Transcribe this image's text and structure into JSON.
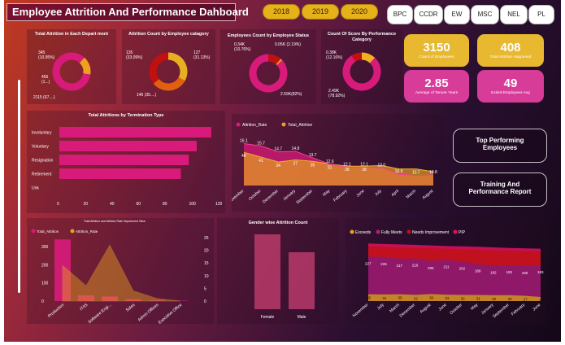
{
  "header": {
    "title": "Employee Attrition And Performance Dahboard"
  },
  "years": [
    "2018",
    "2019",
    "2020"
  ],
  "departments": [
    "BPC",
    "CCDR",
    "EW",
    "MSC",
    "NEL",
    "PL"
  ],
  "kpis": [
    {
      "value": "3150",
      "label": "Count of  Employees",
      "color": "#e8b830"
    },
    {
      "value": "408",
      "label": "Total Attrition Happened",
      "color": "#e8b830"
    },
    {
      "value": "2.85",
      "label": "Average of Tenure Years",
      "color": "#d63c98"
    },
    {
      "value": "49",
      "label": "Exited Employees Avg",
      "color": "#d63c98"
    }
  ],
  "nav_buttons": {
    "top_performing": "Top Performing Employees",
    "training": "Training And Performance Report"
  },
  "donuts": [
    {
      "title": "Total Attrition in Each Depart ment",
      "segments": [
        {
          "value": 345,
          "color": "#d81b7a"
        },
        {
          "value": 456,
          "color": "#f0a020"
        },
        {
          "value": 2115,
          "color": "#d81b7a"
        }
      ],
      "labels": [
        "345\n(10.95%)",
        "456\n(1...)",
        "2115 (67....)"
      ]
    },
    {
      "title": "Attrition Count by Employee catagory",
      "segments": [
        {
          "value": 135,
          "color": "#e8b020"
        },
        {
          "value": 127,
          "color": "#e06010"
        },
        {
          "value": 146,
          "color": "#c01010"
        }
      ],
      "labels": [
        "135\n(33.09%)",
        "127\n(31.13%)",
        "146 (35....)"
      ]
    },
    {
      "title": "Employees Count by Employee Status",
      "segments": [
        {
          "value": 0.34,
          "color": "#c01010"
        },
        {
          "value": 0.05,
          "color": "#f0a020"
        },
        {
          "value": 2.59,
          "color": "#d81b7a"
        }
      ],
      "labels": [
        "0.34K\n(10.76%)",
        "0.05K (2.19%)",
        "2.59K(82%)"
      ]
    },
    {
      "title": "Count Of Score By Performance Category",
      "segments": [
        {
          "value": 0.38,
          "color": "#f0b020"
        },
        {
          "value": 2.49,
          "color": "#d81b7a"
        },
        {
          "value": 0.28,
          "color": "#c01010"
        }
      ],
      "labels": [
        "0.38K\n(12.16%)",
        "2.49K\n(78.92%)"
      ]
    }
  ],
  "termination_chart": {
    "title": "Total Attritions by Termination Type",
    "categories": [
      "Involuntary",
      "Voluntary",
      "Resignation",
      "Retirement",
      "Unk"
    ],
    "values": [
      115,
      104,
      98,
      92,
      0
    ],
    "ticks": [
      "0",
      "20",
      "40",
      "60",
      "80",
      "100",
      "120"
    ]
  },
  "chart_data": [
    {
      "type": "bar",
      "title": "Total Attritions by Termination Type",
      "categories": [
        "Involuntary",
        "Voluntary",
        "Resignation",
        "Retirement",
        "Unk"
      ],
      "values": [
        115,
        104,
        98,
        92,
        0
      ],
      "xlim": [
        0,
        120
      ]
    },
    {
      "type": "area",
      "categories": [
        "November",
        "October",
        "December",
        "January",
        "September",
        "May",
        "February",
        "June",
        "July",
        "April",
        "March",
        "August"
      ],
      "series": [
        {
          "name": "Attrition_Rate",
          "values": [
            16.1,
            15.7,
            14.7,
            14.8,
            13.7,
            12.6,
            12.1,
            12.1,
            12.0,
            10.9,
            10.7,
            10.8
          ]
        },
        {
          "name": "Total_Attrition",
          "values": [
            48,
            41,
            34,
            37,
            35,
            31,
            28,
            28,
            29,
            24,
            24,
            20
          ]
        }
      ],
      "labels_top": [
        "16.1",
        "15.7",
        "14.7",
        "14.8",
        "13.7",
        "12.6",
        "12.1",
        "12.1",
        "12.0",
        "10.9",
        "10.7",
        "10.8"
      ],
      "labels_bottom": [
        "48",
        "41",
        "34",
        "37",
        "35",
        "31",
        "28",
        "28",
        "",
        "",
        "",
        ""
      ]
    },
    {
      "type": "bar",
      "title": "Total Attrition and Attrition Rate Department Wise",
      "categories": [
        "Production",
        "IT/IS",
        "Software Engi...",
        "Sales",
        "Admin Offices",
        "Executive Office"
      ],
      "series": [
        {
          "name": "Total_Attrition",
          "values": [
            340,
            32,
            25,
            10,
            4,
            2
          ]
        },
        {
          "name": "Attrition_Rate",
          "values": [
            14,
            6,
            22,
            4,
            1,
            0
          ]
        }
      ],
      "left_ticks": [
        "0",
        "100",
        "200",
        "300"
      ],
      "right_ticks": [
        "0",
        "5",
        "10",
        "15",
        "20",
        "25"
      ]
    },
    {
      "type": "bar",
      "title": "Gender wise Attrition Count",
      "categories": [
        "Female",
        "Male"
      ],
      "values": [
        230,
        175
      ]
    },
    {
      "type": "area",
      "title": "Count of Performance Score by Month Name and Performance Score",
      "categories": [
        "November",
        "July",
        "March",
        "December",
        "August",
        "June",
        "October",
        "May",
        "January",
        "September",
        "February",
        "June"
      ],
      "series": [
        {
          "name": "Exceeds",
          "values": [
            35,
            34,
            35,
            32,
            36,
            33,
            32,
            31,
            30,
            30,
            27,
            21
          ]
        },
        {
          "name": "Fully Meets",
          "values": [
            227,
            226,
            217,
            218,
            205,
            211,
            202,
            189,
            182,
            183,
            180,
            183
          ]
        },
        {
          "name": "Needs Improvement",
          "values": [
            280,
            278,
            275,
            272,
            270,
            268,
            265,
            262,
            260,
            258,
            255,
            253
          ]
        },
        {
          "name": "PIP",
          "values": [
            295,
            292,
            290,
            288,
            285,
            282,
            280,
            278,
            275,
            272,
            270,
            268
          ]
        }
      ]
    }
  ],
  "area_chart": {
    "legend": [
      {
        "name": "Attrition_Rate",
        "color": "#d81b7a"
      },
      {
        "name": "Total_Attrition",
        "color": "#e8a020"
      }
    ]
  },
  "dept_chart": {
    "title": "Total Attrition and Attrition Rate Department Wise",
    "legend": [
      {
        "name": "Total_Attrition",
        "color": "#d81b7a"
      },
      {
        "name": "Attrition_Rate",
        "color": "#e8a020"
      }
    ]
  },
  "gender_chart": {
    "title": "Gender wise Attrition Count"
  },
  "perf_chart": {
    "legend": [
      {
        "name": "Exceeds",
        "color": "#e8a020"
      },
      {
        "name": "Fully Meets",
        "color": "#b02080"
      },
      {
        "name": "Needs Improvement",
        "color": "#c01010"
      },
      {
        "name": "PIP",
        "color": "#e01060"
      }
    ],
    "value_labels": [
      "227",
      "226",
      "217",
      "216",
      "205",
      "211",
      "202",
      "189",
      "182",
      "183",
      "180",
      "183"
    ],
    "exceeds_labels": [
      "35",
      "34",
      "35",
      "32",
      "36",
      "33",
      "32",
      "31",
      "30",
      "30",
      "27",
      "21"
    ]
  }
}
